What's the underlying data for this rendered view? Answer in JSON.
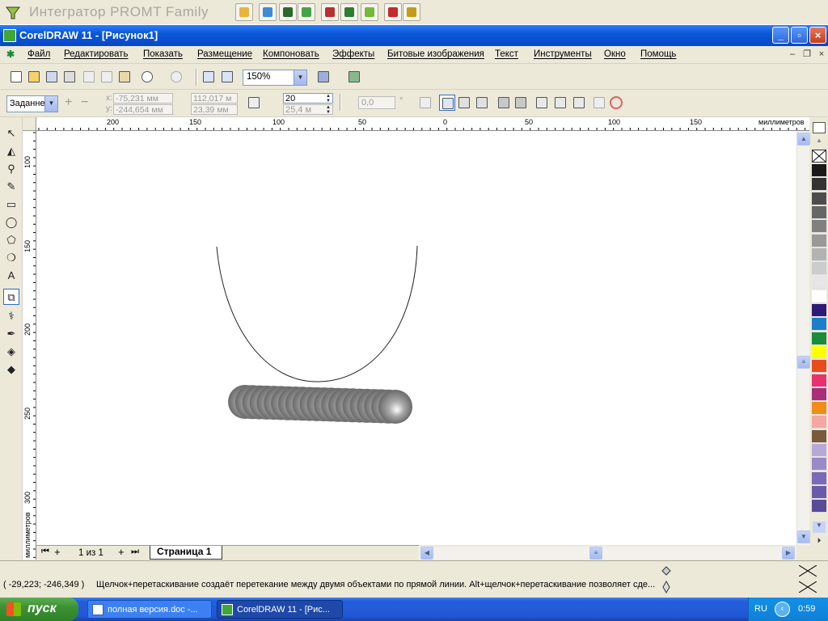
{
  "promt": {
    "title": "Интегратор PROMT Family",
    "buttons": [
      {
        "name": "promt-open-icon",
        "color": "#e8b43a"
      },
      {
        "name": "promt-translate-icon",
        "color": "#3d8ad6"
      },
      {
        "name": "promt-dictionary-icon",
        "color": "#2a6b2a"
      },
      {
        "name": "promt-filter-icon",
        "color": "#46a246"
      },
      {
        "name": "promt-book-icon",
        "color": "#b83030"
      },
      {
        "name": "promt-globe-icon",
        "color": "#2e7d32"
      },
      {
        "name": "promt-web-icon",
        "color": "#76b83a"
      },
      {
        "name": "promt-dict2-icon",
        "color": "#c42a2a"
      },
      {
        "name": "promt-settings-icon",
        "color": "#c79b1a"
      }
    ]
  },
  "window": {
    "title": "CorelDRAW 11 - [Рисунок1]",
    "minimize": "_",
    "maximize": "▫",
    "close": "×"
  },
  "menu": {
    "items": [
      "Файл",
      "Редактировать",
      "Показать",
      "Размещение",
      "Компоновать",
      "Эффекты",
      "Битовые изображения",
      "Текст",
      "Инструменты",
      "Окно",
      "Помощь"
    ]
  },
  "toolbar": {
    "zoom": "150%"
  },
  "propbar": {
    "preset": "Заданне",
    "x_label": "x:",
    "y_label": "y:",
    "x": "-75,231 мм",
    "y": "-244,654 мм",
    "w": "112,017 м",
    "h": "23,39 мм",
    "steps": "20",
    "offset": "25,4 м",
    "angle": "0,0",
    "degree": "°"
  },
  "ruler": {
    "h_labels": [
      "200",
      "150",
      "100",
      "50",
      "0",
      "50",
      "100",
      "150"
    ],
    "h_unit": "миллиметров",
    "v_labels": [
      "100",
      "150",
      "200",
      "250",
      "300"
    ],
    "v_unit": "миллиметров"
  },
  "pages": {
    "counter": "1 из 1",
    "active_tab": "Страница 1"
  },
  "palette": {
    "colors": [
      "#1a1a1a",
      "#333333",
      "#4d4d4d",
      "#666666",
      "#808080",
      "#999999",
      "#b3b3b3",
      "#cccccc",
      "#e6e6e6",
      "#ffffff",
      "#2e1a78",
      "#1a7ec8",
      "#1a8c3a",
      "#ffff00",
      "#e84c1c",
      "#e8326e",
      "#a8307a",
      "#f08c1a",
      "#f4a8a0",
      "#7a5a3a",
      "#b8a8d8",
      "#9a8ac8",
      "#7a6ab8",
      "#6a5aa8",
      "#5a4a98"
    ]
  },
  "status": {
    "coords": "( -29,223; -246,349 )",
    "hint": "Щелчок+перетаскивание создаёт перетекание между двумя объектами по прямой линии. Alt+щелчок+перетаскивание позволяет сде..."
  },
  "taskbar": {
    "start": "пуск",
    "tasks": [
      "полная версия.doc -...",
      "CorelDRAW 11 - [Рис..."
    ],
    "lang": "RU",
    "clock": "0:59"
  }
}
